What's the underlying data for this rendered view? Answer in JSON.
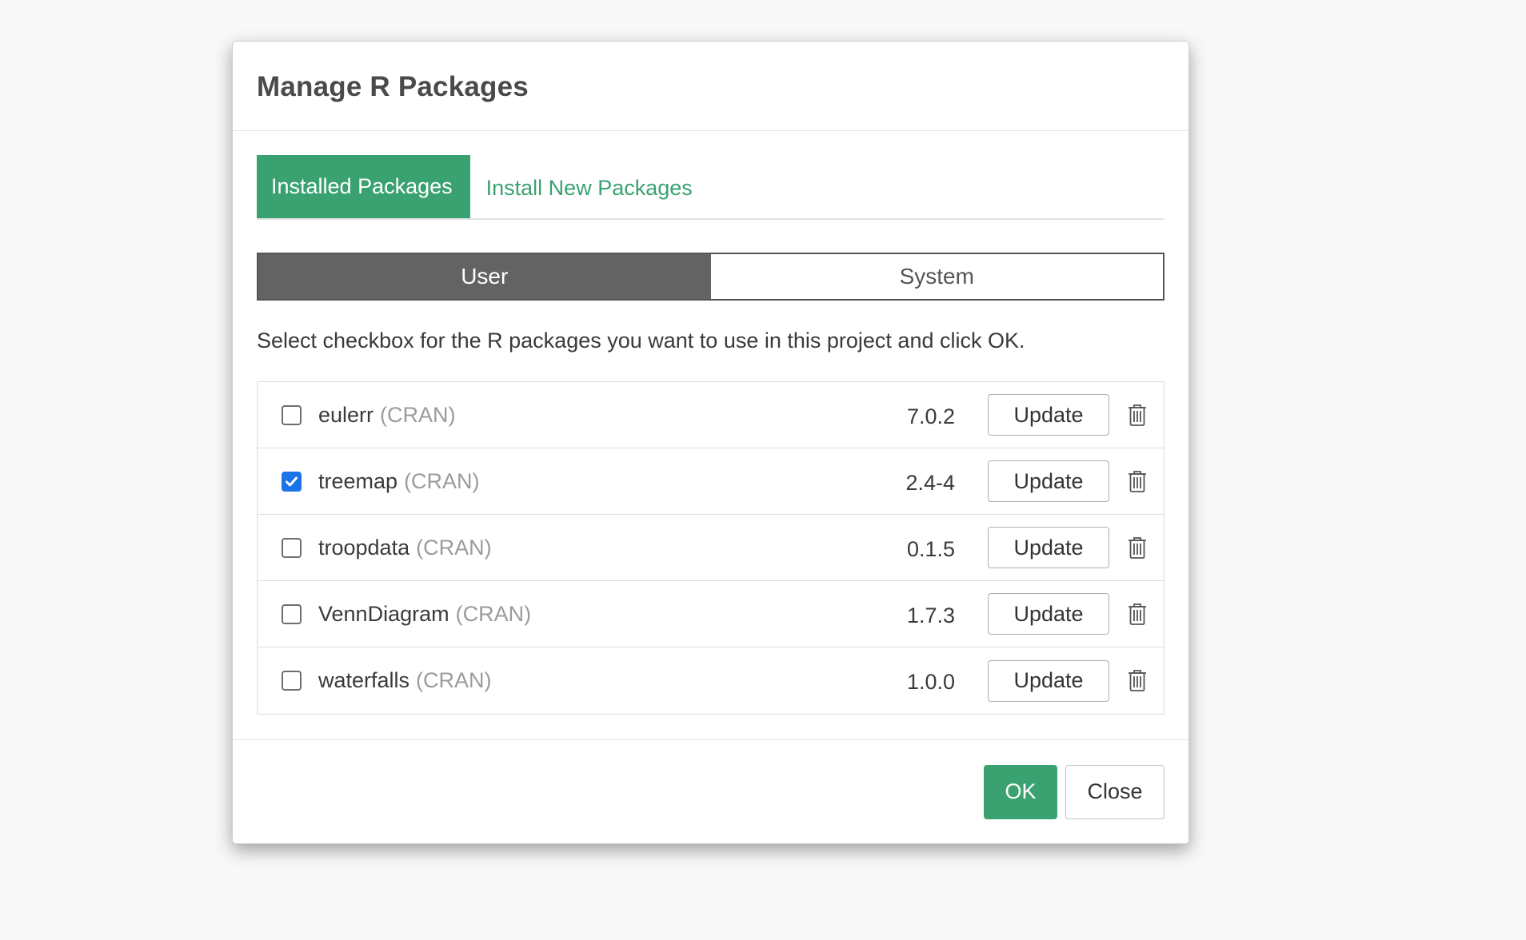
{
  "dialog": {
    "title": "Manage R Packages",
    "tabs": [
      {
        "label": "Installed Packages",
        "active": true
      },
      {
        "label": "Install New Packages",
        "active": false
      }
    ],
    "segments": [
      {
        "label": "User",
        "active": true
      },
      {
        "label": "System",
        "active": false
      }
    ],
    "instruction": "Select checkbox for the R packages you want to use in this project and click OK.",
    "packages": [
      {
        "name": "eulerr",
        "source": "(CRAN)",
        "version": "7.0.2",
        "checked": false,
        "update_label": "Update",
        "icon": "trash-icon"
      },
      {
        "name": "treemap",
        "source": "(CRAN)",
        "version": "2.4-4",
        "checked": true,
        "update_label": "Update",
        "icon": "trash-icon"
      },
      {
        "name": "troopdata",
        "source": "(CRAN)",
        "version": "0.1.5",
        "checked": false,
        "update_label": "Update",
        "icon": "trash-icon"
      },
      {
        "name": "VennDiagram",
        "source": "(CRAN)",
        "version": "1.7.3",
        "checked": false,
        "update_label": "Update",
        "icon": "trash-icon"
      },
      {
        "name": "waterfalls",
        "source": "(CRAN)",
        "version": "1.0.0",
        "checked": false,
        "update_label": "Update",
        "icon": "trash-icon"
      }
    ],
    "footer": {
      "ok_label": "OK",
      "close_label": "Close"
    }
  },
  "colors": {
    "accent": "#3aa271",
    "checkbox_checked": "#1a73e8",
    "segment_active": "#636363"
  }
}
